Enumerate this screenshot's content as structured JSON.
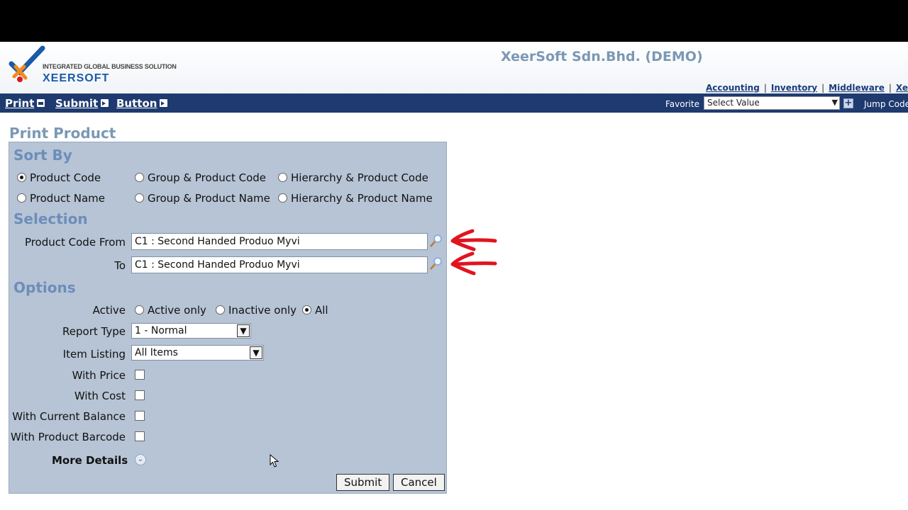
{
  "header": {
    "logo_tagline": "INTEGRATED GLOBAL BUSINESS SOLUTION",
    "logo_name": "XEERSOFT",
    "company": "XeerSoft Sdn.Bhd. (DEMO)",
    "modules": [
      "Accounting",
      "Inventory",
      "Middleware",
      "Xe"
    ]
  },
  "toolbar": {
    "print_label": "Print",
    "submit_label": "Submit",
    "button_label": "Button",
    "favorite_label": "Favorite",
    "favorite_value": "Select Value",
    "jump_label": "Jump Code"
  },
  "page": {
    "title": "Print Product"
  },
  "sort_by": {
    "heading": "Sort By",
    "options": [
      {
        "label": "Product Code",
        "selected": true
      },
      {
        "label": "Group & Product Code",
        "selected": false
      },
      {
        "label": "Hierarchy & Product Code",
        "selected": false
      },
      {
        "label": "Product Name",
        "selected": false
      },
      {
        "label": "Group & Product Name",
        "selected": false
      },
      {
        "label": "Hierarchy & Product Name",
        "selected": false
      }
    ]
  },
  "selection": {
    "heading": "Selection",
    "from_label": "Product Code From",
    "from_value": "C1 : Second Handed Produo Myvi",
    "to_label": "To",
    "to_value": "C1 : Second Handed Produo Myvi"
  },
  "options": {
    "heading": "Options",
    "active_label": "Active",
    "active_choices": [
      {
        "label": "Active only",
        "selected": false
      },
      {
        "label": "Inactive only",
        "selected": false
      },
      {
        "label": "All",
        "selected": true
      }
    ],
    "report_type_label": "Report Type",
    "report_type_value": "1 - Normal",
    "item_listing_label": "Item Listing",
    "item_listing_value": "All Items",
    "with_price_label": "With Price",
    "with_cost_label": "With Cost",
    "with_balance_label": "With Current Balance",
    "with_barcode_label": "With Product Barcode",
    "more_details_label": "More Details"
  },
  "actions": {
    "submit_label": "Submit",
    "cancel_label": "Cancel"
  },
  "colors": {
    "navbar": "#1e3a6f",
    "panel": "#b6c4d5",
    "section_heading": "#6d8dba",
    "annotation_arrow": "#e0141e"
  }
}
